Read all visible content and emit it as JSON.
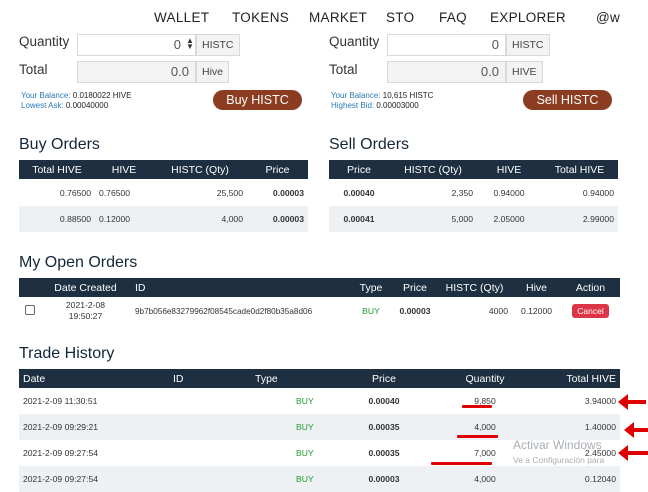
{
  "nav": [
    "WALLET",
    "TOKENS",
    "MARKET",
    "STO",
    "FAQ",
    "EXPLORER",
    "@w"
  ],
  "buy_form": {
    "quantity_label": "Quantity",
    "quantity_value": "0",
    "quantity_unit": "HISTC",
    "total_label": "Total",
    "total_value": "0.0",
    "total_unit": "Hive",
    "balance_label": "Your Balance:",
    "balance_value": "0.0180022 HIVE",
    "lowest_ask_label": "Lowest Ask:",
    "lowest_ask_value": "0.00040000",
    "button": "Buy HISTC"
  },
  "sell_form": {
    "quantity_label": "Quantity",
    "quantity_value": "0",
    "quantity_unit": "HISTC",
    "total_label": "Total",
    "total_value": "0.0",
    "total_unit": "HIVE",
    "balance_label": "Your Balance:",
    "balance_value": "10,615 HISTC",
    "highest_bid_label": "Highest Bid:",
    "highest_bid_value": "0.00003000",
    "button": "Sell HISTC"
  },
  "buy_orders": {
    "title": "Buy Orders",
    "headers": [
      "Total HIVE",
      "HIVE",
      "HISTC (Qty)",
      "Price"
    ],
    "rows": [
      [
        "0.76500",
        "0.76500",
        "25,500",
        "0.00003"
      ],
      [
        "0.88500",
        "0.12000",
        "4,000",
        "0.00003"
      ]
    ]
  },
  "sell_orders": {
    "title": "Sell Orders",
    "headers": [
      "Price",
      "HISTC (Qty)",
      "HIVE",
      "Total HIVE"
    ],
    "rows": [
      [
        "0.00040",
        "2,350",
        "0.94000",
        "0.94000"
      ],
      [
        "0.00041",
        "5,000",
        "2.05000",
        "2.99000"
      ]
    ]
  },
  "open_orders": {
    "title": "My Open Orders",
    "headers": [
      "Date Created",
      "ID",
      "Type",
      "Price",
      "HISTC (Qty)",
      "Hive",
      "Action"
    ],
    "rows": [
      {
        "date": "2021-2-08",
        "time": "19:50:27",
        "id": "9b7b056e83279962f08545cade0d2f80b35a8d06",
        "type": "BUY",
        "price": "0.00003",
        "qty": "4000",
        "hive": "0.12000",
        "action": "Cancel"
      }
    ]
  },
  "trade_history": {
    "title": "Trade History",
    "headers": [
      "Date",
      "ID",
      "Type",
      "Price",
      "Quantity",
      "Total HIVE"
    ],
    "rows": [
      [
        "2021-2-09 11:30:51",
        "",
        "BUY",
        "0.00040",
        "9,850",
        "3.94000"
      ],
      [
        "2021-2-09 09:29:21",
        "",
        "BUY",
        "0.00035",
        "4,000",
        "1.40000"
      ],
      [
        "2021-2-09 09:27:54",
        "",
        "BUY",
        "0.00035",
        "7,000",
        "2.45000"
      ],
      [
        "2021-2-09 09:27:54",
        "",
        "BUY",
        "0.00003",
        "4,000",
        "0.12040"
      ]
    ]
  },
  "watermark": {
    "line1": "Activar Windows",
    "line2": "Ve a Configuración para"
  },
  "colors": {
    "header_bg": "#1d2f40",
    "button": "#8b3c21",
    "buy_text": "#1f9d2f",
    "cancel": "#dc3545",
    "annotation": "#e00000"
  }
}
